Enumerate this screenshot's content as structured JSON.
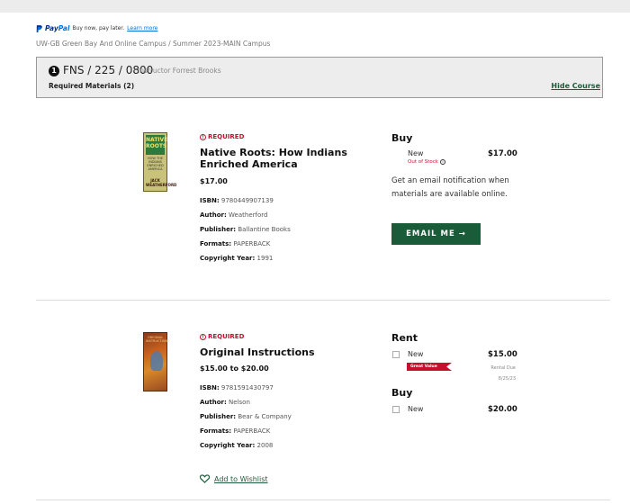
{
  "paypal": {
    "brand_pay": "Pay",
    "brand_pal": "Pal",
    "tagline": "Buy now, pay later.",
    "learn_more": "Learn more"
  },
  "campus_path": "UW-GB Green Bay And Online Campus / Summer 2023-MAIN Campus",
  "course": {
    "number": "1",
    "code": "FNS / 225 / 0800",
    "instructor": "Instructor Forrest Brooks",
    "required_materials": "Required Materials (2)",
    "hide_label": "Hide Course"
  },
  "books": [
    {
      "cover_text": [
        "NATIVE",
        "ROOTS",
        "HOW THE INDIANS ENRICHED AMERICA",
        "JACK WEATHERFORD"
      ],
      "badge": "REQUIRED",
      "title": "Native Roots: How Indians Enriched America",
      "price": "$17.00",
      "isbn_label": "ISBN:",
      "isbn": "9780449907139",
      "author_label": "Author:",
      "author": "Weatherford",
      "publisher_label": "Publisher:",
      "publisher": "Ballantine Books",
      "formats_label": "Formats:",
      "formats": "PAPERBACK",
      "year_label": "Copyright Year:",
      "year": "1991",
      "buy": {
        "heading": "Buy",
        "option": "New",
        "status": "Out of Stock",
        "price": "$17.00"
      },
      "notify_text": "Get an email notification when materials are available online.",
      "email_button": "EMAIL ME",
      "email_arrow": "→"
    },
    {
      "cover_text": [
        "ORIGINAL INSTRUCTIONS"
      ],
      "badge": "REQUIRED",
      "title": "Original Instructions",
      "price": "$15.00 to $20.00",
      "isbn_label": "ISBN:",
      "isbn": "9781591430797",
      "author_label": "Author:",
      "author": "Nelson",
      "publisher_label": "Publisher:",
      "publisher": "Bear & Company",
      "formats_label": "Formats:",
      "formats": "PAPERBACK",
      "year_label": "Copyright Year:",
      "year": "2008",
      "rent": {
        "heading": "Rent",
        "option": "New",
        "price": "$15.00",
        "tag": "Great Value",
        "due_label": "Rental Due",
        "due_date": "8/25/23"
      },
      "buy": {
        "heading": "Buy",
        "option": "New",
        "price": "$20.00"
      },
      "wishlist": "Add to Wishlist"
    }
  ],
  "colors": {
    "accent_green": "#1a5c3a",
    "required_red": "#c8102e",
    "paypal_blue": "#003087"
  }
}
